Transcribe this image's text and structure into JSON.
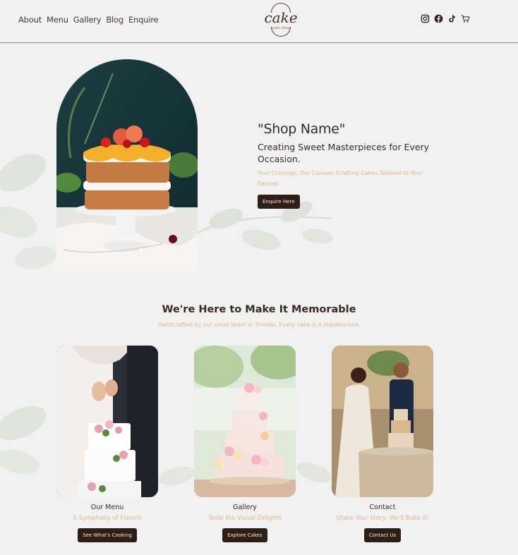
{
  "nav": {
    "items": [
      {
        "label": "About"
      },
      {
        "label": "Menu"
      },
      {
        "label": "Gallery"
      },
      {
        "label": "Blog"
      },
      {
        "label": "Enquire"
      }
    ]
  },
  "logo": {
    "word": "cake",
    "subtext": "cake shop"
  },
  "social": {
    "icons": [
      "instagram-icon",
      "facebook-icon",
      "tiktok-icon",
      "cart-icon"
    ]
  },
  "hero": {
    "shop_name": "\"Shop Name\"",
    "subtitle": "Creating Sweet Masterpieces for Every Occasion.",
    "description": "Your Cravings, Our Canvas: Crafting Cakes Tailored to Your Desires",
    "button": "Enquire Here"
  },
  "section": {
    "title": "We're Here to Make It Memorable",
    "subtitle": "Handcrafted by our small team in Toronto, Every cake is a masterpiece."
  },
  "cards": [
    {
      "title": "Our Menu",
      "subtitle": "A Symphony of Flavors",
      "button": "See What's Cooking"
    },
    {
      "title": "Gallery",
      "subtitle": "Taste the Visual Delights",
      "button": "Explore Cakes"
    },
    {
      "title": "Contact",
      "subtitle": "Share Your Story, We'll Bake It!",
      "button": "Contact Us"
    }
  ],
  "colors": {
    "background": "#f1f1f1",
    "text": "#3a2a24",
    "accent": "#e2b58a",
    "button": "#2e1e18"
  }
}
